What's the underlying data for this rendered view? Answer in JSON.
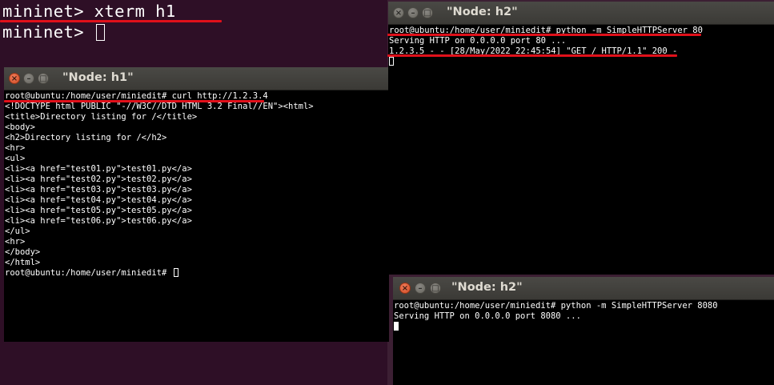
{
  "colors": {
    "desktop_bg": "#3c1f33",
    "terminal_bg": "#000000",
    "annotation_red": "#e0101a",
    "close_button": "#e05a32"
  },
  "background_terminal": {
    "line1": "mininet> xterm h1",
    "line2_prompt": "mininet> "
  },
  "windows": {
    "h1": {
      "title": "\"Node: h1\"",
      "lines": [
        "root@ubuntu:/home/user/miniedit# curl http://1.2.3.4",
        "<!DOCTYPE html PUBLIC \"-//W3C//DTD HTML 3.2 Final//EN\"><html>",
        "<title>Directory listing for /</title>",
        "<body>",
        "<h2>Directory listing for /</h2>",
        "<hr>",
        "<ul>",
        "<li><a href=\"test01.py\">test01.py</a>",
        "<li><a href=\"test02.py\">test02.py</a>",
        "<li><a href=\"test03.py\">test03.py</a>",
        "<li><a href=\"test04.py\">test04.py</a>",
        "<li><a href=\"test05.py\">test05.py</a>",
        "<li><a href=\"test06.py\">test06.py</a>",
        "</ul>",
        "<hr>",
        "</body>",
        "</html>"
      ],
      "final_prompt": "root@ubuntu:/home/user/miniedit# "
    },
    "h2_top": {
      "title": "\"Node: h2\"",
      "lines": [
        "root@ubuntu:/home/user/miniedit# python -m SimpleHTTPServer 80",
        "Serving HTTP on 0.0.0.0 port 80 ...",
        "1.2.3.5 - - [28/May/2022 22:45:54] \"GET / HTTP/1.1\" 200 -"
      ]
    },
    "h2_bottom": {
      "title": "\"Node: h2\"",
      "lines": [
        "root@ubuntu:/home/user/miniedit# python -m SimpleHTTPServer 8080",
        "Serving HTTP on 0.0.0.0 port 8080 ..."
      ]
    }
  }
}
